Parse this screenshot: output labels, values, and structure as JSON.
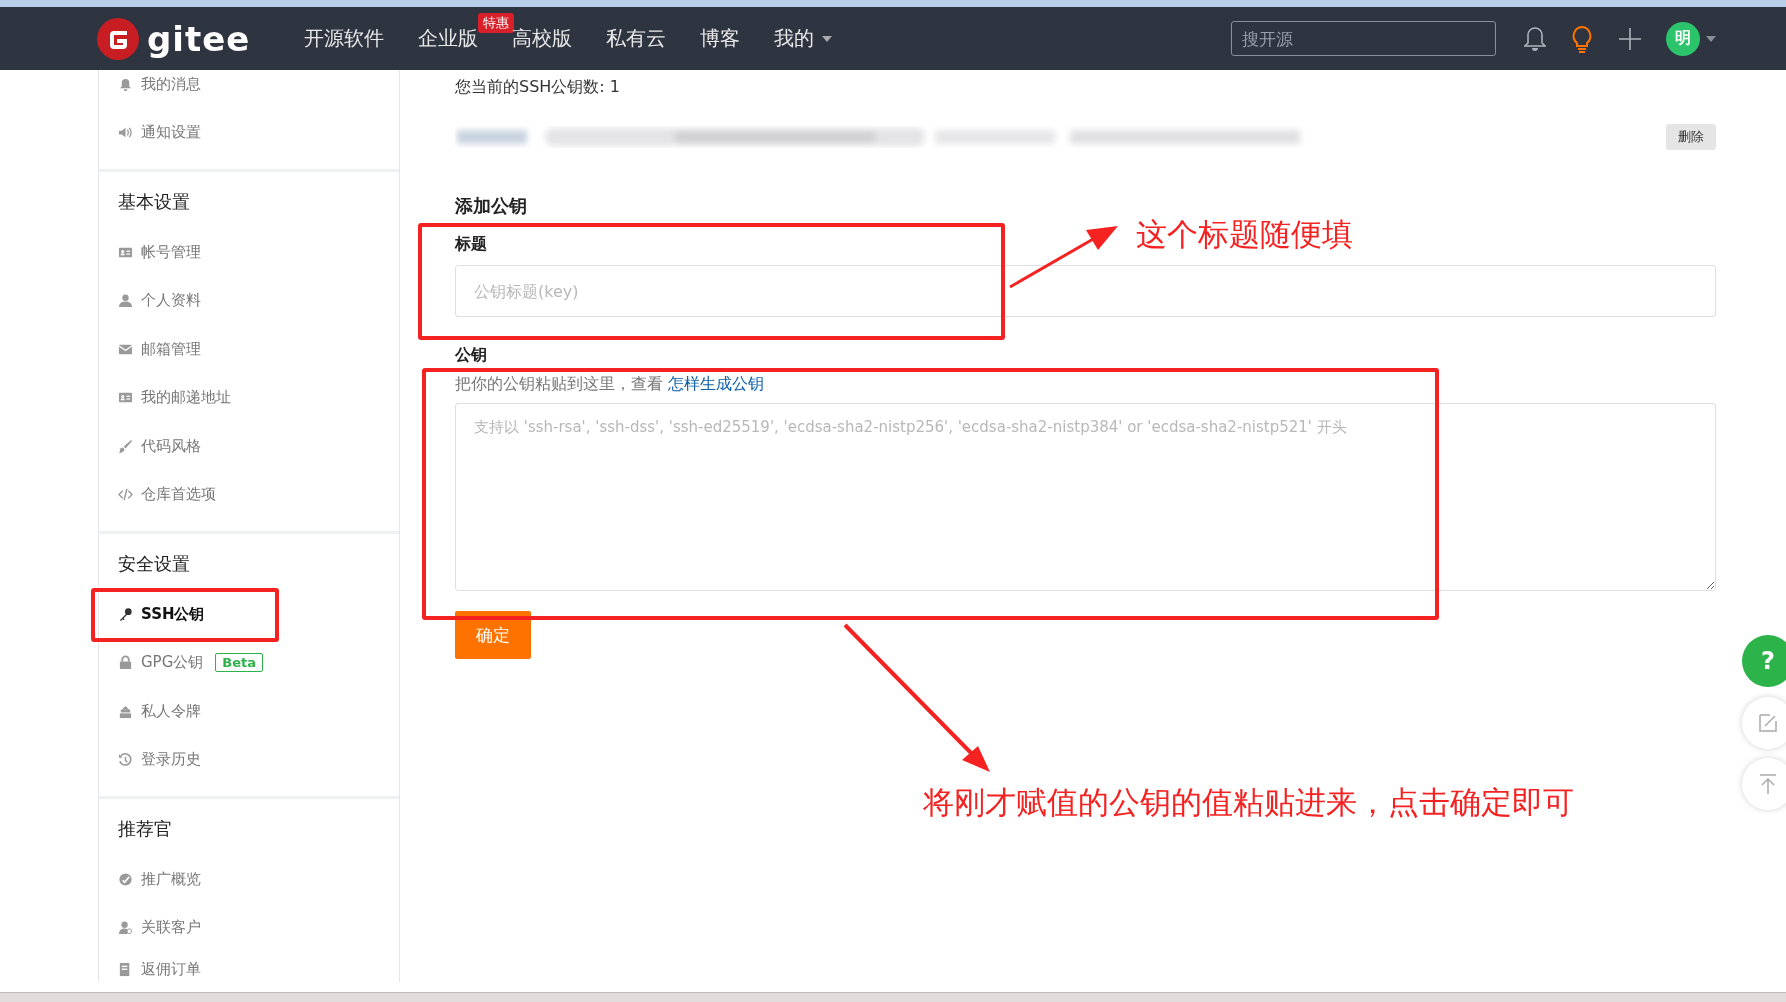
{
  "navbar": {
    "logo": "gitee",
    "menu": [
      {
        "label": "开源软件",
        "dropdown": false
      },
      {
        "label": "企业版",
        "badge": "特惠",
        "dropdown": false
      },
      {
        "label": "高校版",
        "dropdown": false
      },
      {
        "label": "私有云",
        "dropdown": false
      },
      {
        "label": "博客",
        "dropdown": false
      },
      {
        "label": "我的",
        "dropdown": true
      }
    ],
    "search": {
      "placeholder": "搜开源"
    },
    "avatar": "明"
  },
  "sidebar": {
    "groups": [
      {
        "items": [
          {
            "label": "我的消息",
            "selected": false
          },
          {
            "label": "通知设置",
            "selected": false
          }
        ]
      },
      {
        "title": "基本设置",
        "items": [
          {
            "label": "帐号管理",
            "selected": false
          },
          {
            "label": "个人资料",
            "selected": false
          },
          {
            "label": "邮箱管理",
            "selected": false
          },
          {
            "label": "我的邮递地址",
            "selected": false
          },
          {
            "label": "代码风格",
            "selected": false
          },
          {
            "label": "仓库首选项",
            "selected": false
          }
        ]
      },
      {
        "title": "安全设置",
        "items": [
          {
            "label": "SSH公钥",
            "selected": true
          },
          {
            "label": "GPG公钥",
            "badge": "Beta",
            "selected": false
          },
          {
            "label": "私人令牌",
            "selected": false
          },
          {
            "label": "登录历史",
            "selected": false
          }
        ]
      },
      {
        "title": "推荐官",
        "items": [
          {
            "label": "推广概览",
            "selected": false
          },
          {
            "label": "关联客户",
            "selected": false
          },
          {
            "label": "返佣订单",
            "selected": false
          }
        ]
      }
    ]
  },
  "main": {
    "key_count": "您当前的SSH公钥数: 1",
    "delete_button": "删除",
    "section_title": "添加公钥",
    "title_field": {
      "label": "标题",
      "placeholder": "公钥标题(key)"
    },
    "key_field": {
      "label": "公钥",
      "hint": "把你的公钥粘贴到这里，查看",
      "hint_link": "怎样生成公钥",
      "placeholder": "支持以 'ssh-rsa', 'ssh-dss', 'ssh-ed25519', 'ecdsa-sha2-nistp256', 'ecdsa-sha2-nistp384' or 'ecdsa-sha2-nistp521' 开头"
    },
    "submit": "确定"
  },
  "float_help": "?",
  "annotations": [
    {
      "text": "这个标题随便填"
    },
    {
      "text": "将刚才赋值的公钥的值粘贴进来，点击确定即可"
    }
  ]
}
